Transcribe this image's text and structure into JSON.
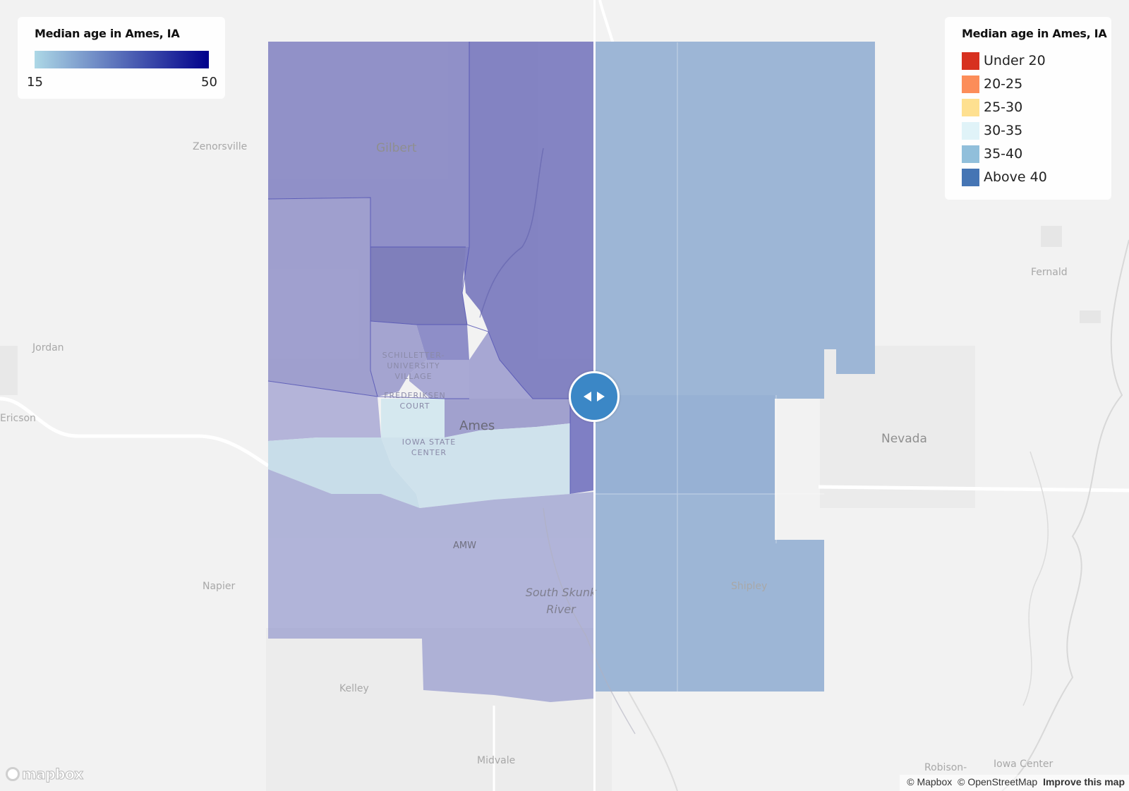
{
  "map": {
    "places": {
      "zenorsville": "Zenorsville",
      "gilbert": "Gilbert",
      "jordan": "Jordan",
      "ericson": "Ericson",
      "ames": "Ames",
      "nevada": "Nevada",
      "fernald": "Fernald",
      "napier": "Napier",
      "shipley": "Shipley",
      "kelley": "Kelley",
      "midvale": "Midvale",
      "robison": "Robison-",
      "iowa_center": "Iowa Center",
      "airport": "AMW",
      "river": "South Skunk River",
      "poi_schilletter": "SCHILLETTER-UNIVERSITY VILLAGE",
      "poi_fredericksen": "FREDERIKSEN COURT",
      "poi_isu": "IOWA STATE CENTER"
    }
  },
  "legend_gradient": {
    "title": "Median age in Ames, IA",
    "min_label": "15",
    "max_label": "50",
    "color_low": "#add8e6",
    "color_high": "#00008b"
  },
  "legend_classes": {
    "title": "Median age in Ames, IA",
    "items": [
      {
        "label": "Under 20",
        "color": "#d7301f"
      },
      {
        "label": "20-25",
        "color": "#fc8d59"
      },
      {
        "label": "25-30",
        "color": "#fee090"
      },
      {
        "label": "30-35",
        "color": "#e0f3f8"
      },
      {
        "label": "35-40",
        "color": "#91bfdb"
      },
      {
        "label": "Above 40",
        "color": "#4575b4"
      }
    ]
  },
  "compare_slider": {
    "handle_icon": "left-right-arrows-icon"
  },
  "attribution": {
    "logo": "mapbox",
    "mapbox": "© Mapbox",
    "osm": "© OpenStreetMap",
    "improve": "Improve this map"
  }
}
